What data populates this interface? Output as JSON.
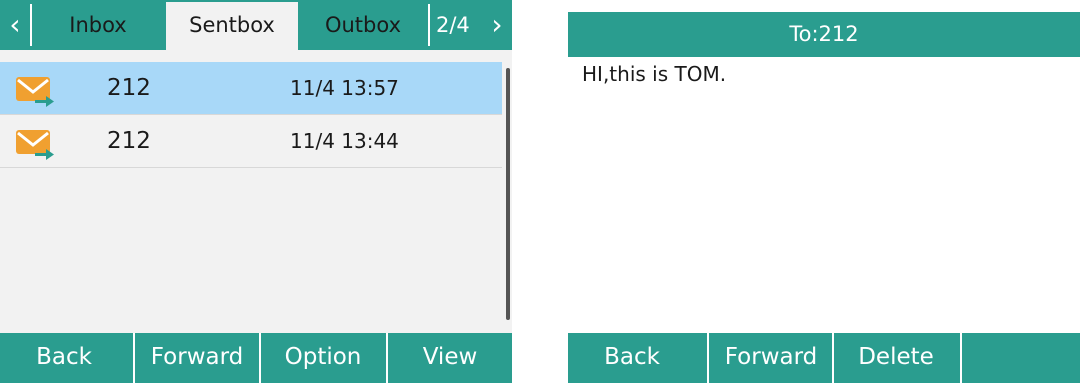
{
  "left_screen": {
    "tabs": [
      {
        "label": "Inbox",
        "active": false
      },
      {
        "label": "Sentbox",
        "active": true
      },
      {
        "label": "Outbox",
        "active": false
      }
    ],
    "page_indicator": "2/4",
    "nav_icons": {
      "prev": "chevron-left-icon",
      "next": "chevron-right-icon"
    },
    "messages": [
      {
        "number": "212",
        "time": "11/4 13:57",
        "selected": true,
        "icon": "sent-mail-icon"
      },
      {
        "number": "212",
        "time": "11/4 13:44",
        "selected": false,
        "icon": "sent-mail-icon"
      }
    ],
    "softkeys": [
      "Back",
      "Forward",
      "Option",
      "View"
    ]
  },
  "right_screen": {
    "title": "To:212",
    "message_text": "HI,this is TOM.",
    "softkeys": [
      "Back",
      "Forward",
      "Delete",
      ""
    ]
  },
  "colors": {
    "accent": "#2a9d8f",
    "selected_row": "#a8d8f8",
    "envelope": "#f0a030",
    "arrow": "#2a9d8f"
  }
}
